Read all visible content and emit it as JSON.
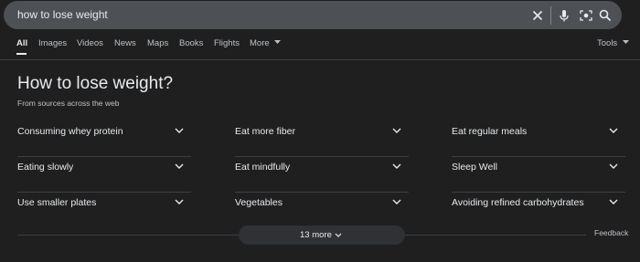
{
  "search": {
    "query": "how to lose weight"
  },
  "tabs": [
    {
      "label": "All",
      "active": true
    },
    {
      "label": "Images"
    },
    {
      "label": "Videos"
    },
    {
      "label": "News"
    },
    {
      "label": "Maps"
    },
    {
      "label": "Books"
    },
    {
      "label": "Flights"
    },
    {
      "label": "More"
    }
  ],
  "tools_label": "Tools",
  "panel": {
    "heading": "How to lose weight?",
    "subheading": "From sources across the web",
    "questions": [
      "Consuming whey protein",
      "Eat more fiber",
      "Eat regular meals",
      "Eating slowly",
      "Eat mindfully",
      "Sleep Well",
      "Use smaller plates",
      "Vegetables",
      "Avoiding refined carbohydrates"
    ],
    "more_label": "13 more",
    "feedback_label": "Feedback"
  },
  "icons": {
    "clear": "close-icon",
    "voice": "microphone-icon",
    "lens": "camera-search-icon",
    "search": "search-icon",
    "expand": "chevron-down-icon"
  },
  "colors": {
    "background": "#1f1f1f",
    "search_bar": "#4d5156",
    "text": "#e8eaed",
    "muted": "#bdc1c6"
  }
}
